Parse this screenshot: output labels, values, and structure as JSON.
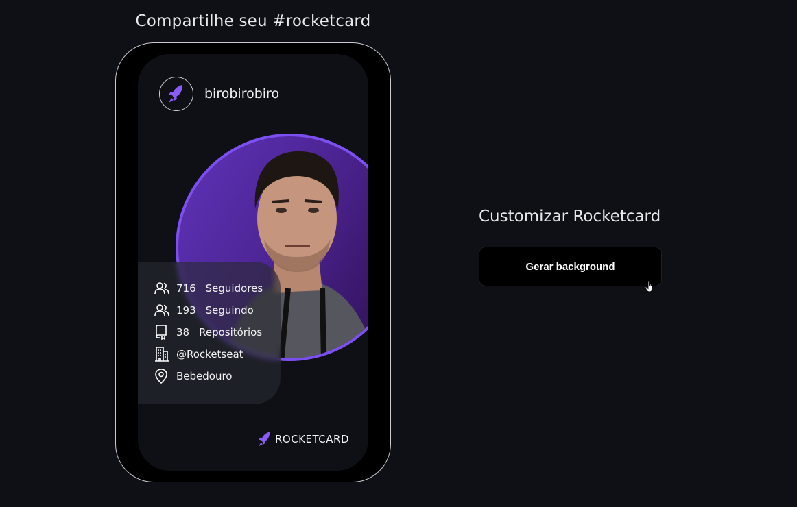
{
  "header": {
    "share_title": "Compartilhe seu #rocketcard"
  },
  "card": {
    "username": "birobirobiro",
    "stats": [
      {
        "icon": "users-icon",
        "value": "716",
        "label": "Seguidores"
      },
      {
        "icon": "users-icon",
        "value": "193",
        "label": "Seguindo"
      },
      {
        "icon": "book-icon",
        "value": "38",
        "label": "Repositórios"
      },
      {
        "icon": "building-icon",
        "value": "",
        "label": "@Rocketseat"
      },
      {
        "icon": "map-pin-icon",
        "value": "",
        "label": "Bebedouro"
      }
    ],
    "brand": "ROCKETCARD"
  },
  "customize": {
    "title": "Customizar Rocketcard",
    "button_label": "Gerar background"
  },
  "colors": {
    "accent": "#7c4ff0",
    "background": "#0e1016",
    "frame": "#000000"
  }
}
